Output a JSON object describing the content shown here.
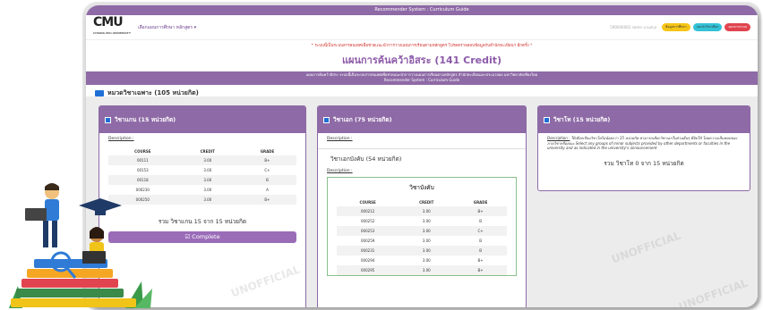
{
  "header": {
    "system_title": "Recommender System : Curriculum Guide",
    "logo_text": "CMU",
    "logo_sub": "CHIANG MAI UNIVERSITY",
    "menu_label": "เลือกแผนการศึกษา หลักสูตร",
    "user_text": "590000002 name นามสกุล",
    "buttons": [
      "ข้อมูลการศึกษา",
      "แนะนำวิชาเลือก",
      "ออกจากระบบ"
    ]
  },
  "notice": "* ระบบนี้เป็นระบบสารสนเทศเพื่อช่วยแนะนำการวางแผนการเรียนตามหลักสูตร โปรดตรวจสอบข้อมูลกับสำนักทะเบียนฯ อีกครั้ง *",
  "headline": "แผนการค้นคว้าอิสระ (141 Credit)",
  "band": {
    "line1": "แผนการค้นคว้าอิสระ ระบบนี้เป็นระบบสารสนเทศเพื่อช่วยแนะนำการวางแผนการเรียนตามหลักสูตร สำนักทะเบียนและประมวลผล มหาวิทยาลัยเชียงใหม่",
    "line2": "Recommender System : Curriculum Guide"
  },
  "section_title": "หมวดวิชาเฉพาะ (105 หน่วยกิต)",
  "watermark": "UNOFFICIAL",
  "cards": {
    "core": {
      "title": "วิชาแกน (15 หน่วยกิต)",
      "description_label": "Description :",
      "columns": [
        "COURSE",
        "CREDIT",
        "GRADE"
      ],
      "rows": [
        [
          "00111",
          "3.00",
          "B+"
        ],
        [
          "00153",
          "3.00",
          "C+"
        ],
        [
          "00118",
          "3.00",
          "B"
        ],
        [
          "000230",
          "3.00",
          "A"
        ],
        [
          "000250",
          "3.00",
          "B+"
        ]
      ],
      "total": "รวม วิชาแกน 15 จาก 15 หน่วยกิต",
      "complete_label": "Complete"
    },
    "major": {
      "title": "วิชาเอก (75 หน่วยกิต)",
      "description_label": "Description :",
      "sub_title": "วิชาเอกบังคับ (54 หน่วยกิต)",
      "sub_description_label": "Description :",
      "inner_title": "วิชาบังคับ",
      "columns": [
        "COURSE",
        "CREDIT",
        "GRADE"
      ],
      "rows": [
        [
          "000212",
          "3.00",
          "B+"
        ],
        [
          "000252",
          "3.00",
          "B"
        ],
        [
          "000253",
          "3.00",
          "C+"
        ],
        [
          "000259",
          "3.00",
          "B"
        ],
        [
          "000231",
          "3.00",
          "B"
        ],
        [
          "000294",
          "3.00",
          "B+"
        ],
        [
          "000295",
          "3.00",
          "B+"
        ]
      ]
    },
    "minor": {
      "title": "วิชาโท (15 หน่วยกิต)",
      "description_label": "Description :",
      "description_text": "ให้เลือกเรียนวิชาโทไม่น้อยกว่า 15 หน่วยกิต สามารถเลือกวิชาเอกในส่วนอื่นๆ ที่จัดให้ โดยความเห็นชอบของภาควิชาหรือคณะ Select any groups of minor subjects provided by other departments or faculties in the university and as indicated in the university's announcement",
      "total": "รวม วิชาโท 0 จาก 15 หน่วยกิต"
    }
  }
}
